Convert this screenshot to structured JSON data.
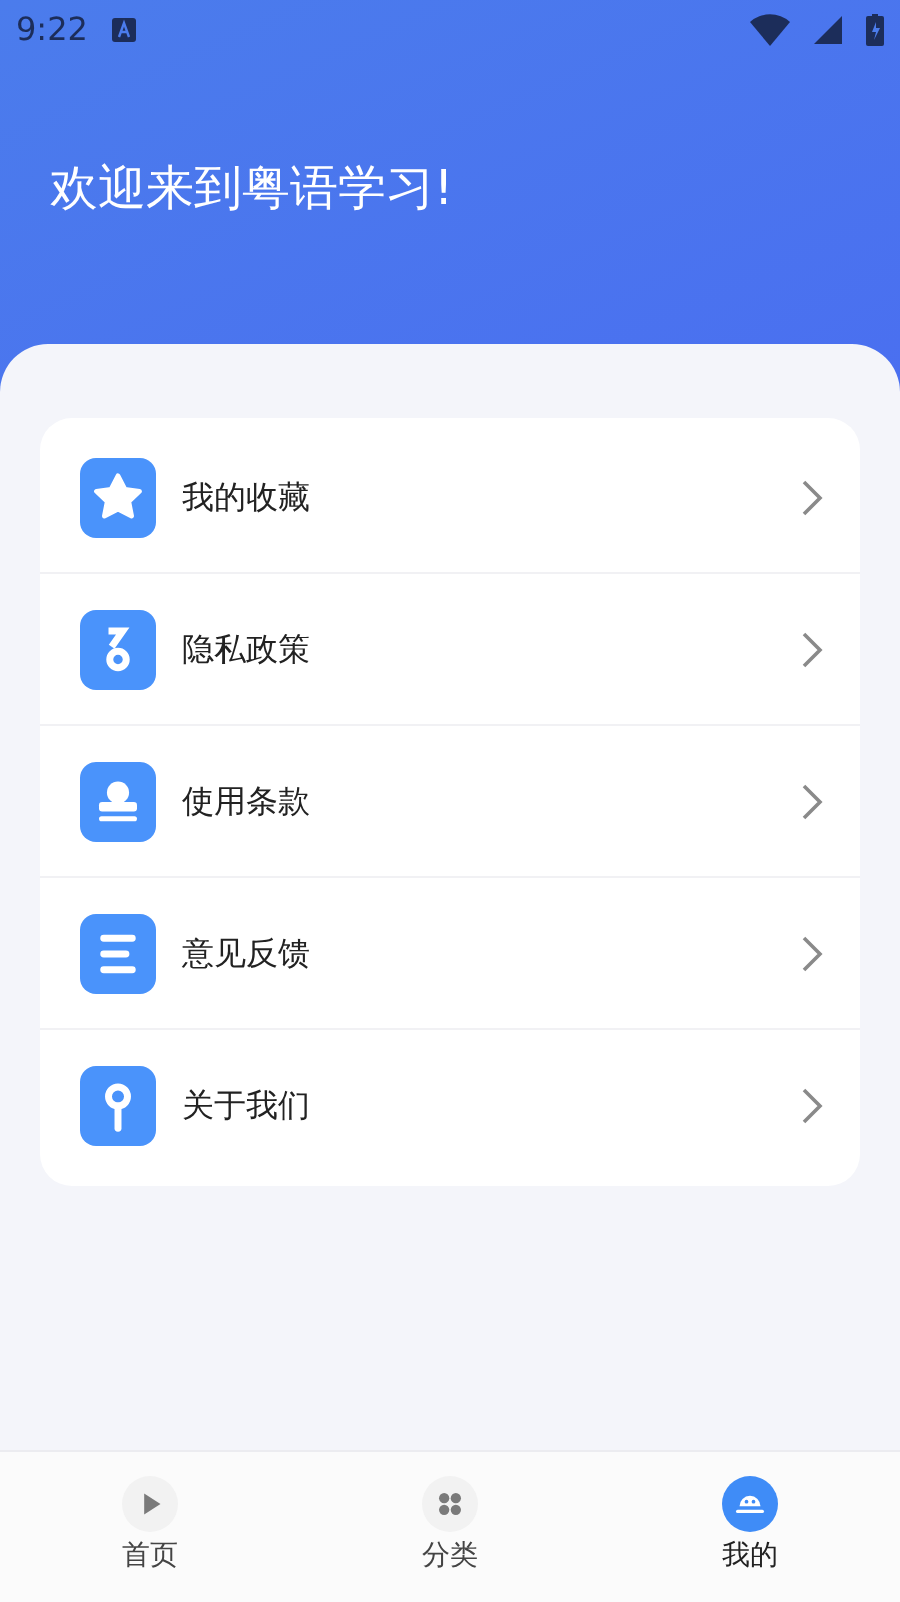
{
  "status_bar": {
    "time": "9:22"
  },
  "header": {
    "title": "欢迎来到粤语学习!"
  },
  "menu": [
    {
      "label": "我的收藏",
      "kind": "star"
    },
    {
      "label": "隐私政策",
      "kind": "key"
    },
    {
      "label": "使用条款",
      "kind": "stamp"
    },
    {
      "label": "意见反馈",
      "kind": "lines"
    },
    {
      "label": "关于我们",
      "kind": "pin"
    }
  ],
  "tabs": [
    {
      "label": "首页",
      "kind": "play",
      "selected": false
    },
    {
      "label": "分类",
      "kind": "grid",
      "selected": false
    },
    {
      "label": "我的",
      "kind": "face",
      "selected": true
    }
  ]
}
